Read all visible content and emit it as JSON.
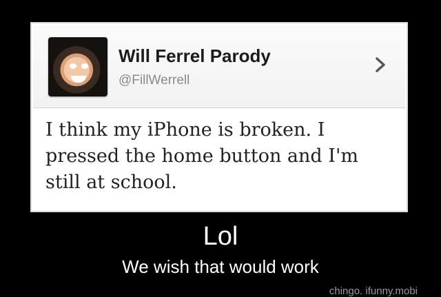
{
  "tweet": {
    "display_name": "Will Ferrel Parody",
    "handle": "@FillWerrell",
    "text": "I think my iPhone is broken. I pressed the home button and I'm still at school."
  },
  "caption": {
    "title": "Lol",
    "subtitle": "We wish that would work"
  },
  "watermark": "chingo. ifunny.mobi",
  "icons": {
    "chevron": "chevron-right-icon",
    "avatar": "profile-avatar"
  }
}
